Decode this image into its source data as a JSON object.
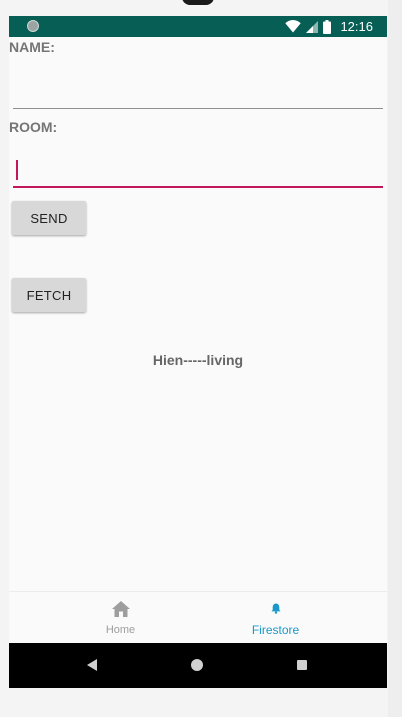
{
  "status_bar": {
    "time": "12:16",
    "icons": [
      "notification-dot-icon",
      "wifi-icon",
      "signal-icon",
      "battery-icon"
    ]
  },
  "form": {
    "name_label": "NAME:",
    "name_value": "",
    "room_label": "ROOM:",
    "room_value": "",
    "send_label": "SEND",
    "fetch_label": "FETCH"
  },
  "result_text": "Hien-----living",
  "bottom_nav": {
    "items": [
      {
        "label": "Home",
        "icon": "home-icon",
        "active": false
      },
      {
        "label": "Firestore",
        "icon": "bell-icon",
        "active": true
      }
    ]
  },
  "system_nav": [
    "back-icon",
    "home-circle-icon",
    "recents-icon"
  ],
  "colors": {
    "status_bar": "#075e54",
    "focus_accent": "#c2185b",
    "nav_active": "#1a98c7",
    "nav_inactive": "#9e9e9e"
  }
}
